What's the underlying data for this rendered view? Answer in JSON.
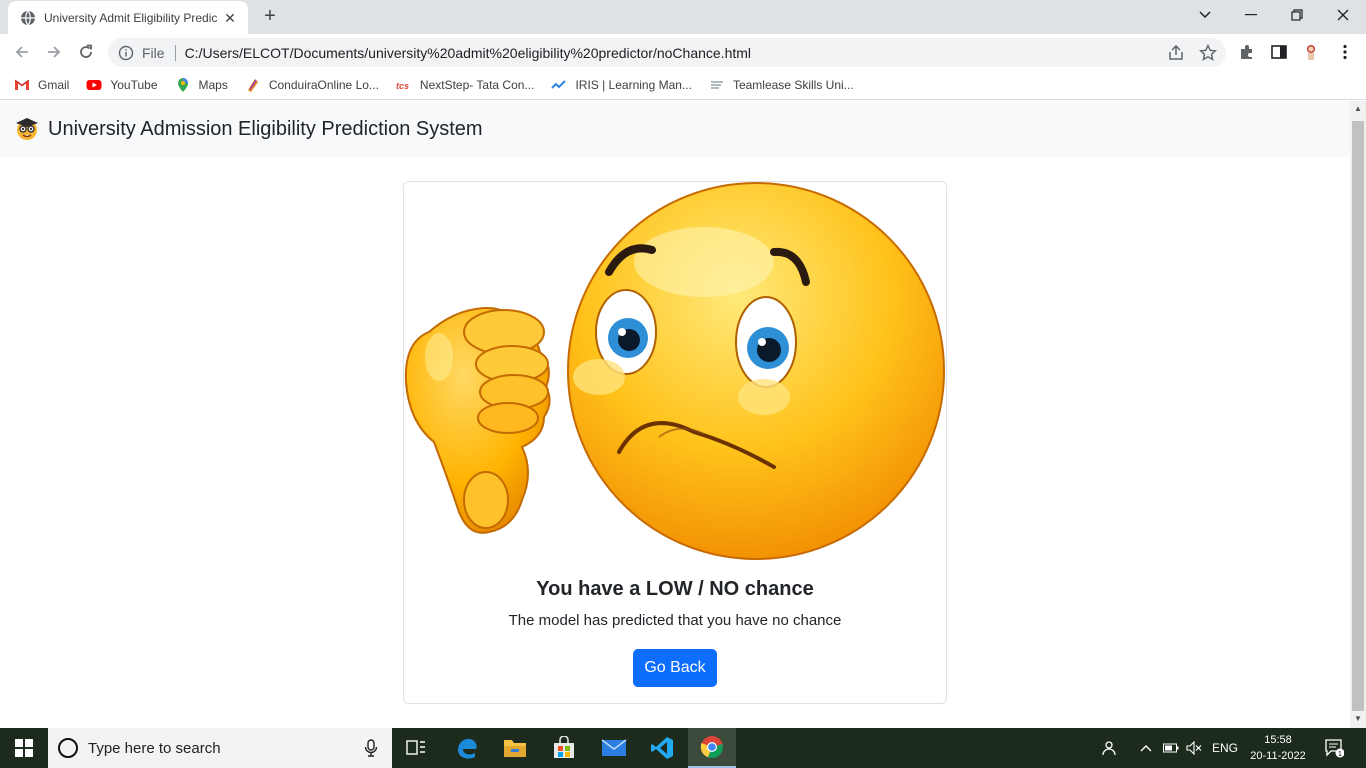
{
  "browser": {
    "tab_title": "University Admit Eligibility Predic",
    "url_scheme_label": "File",
    "url": "C:/Users/ELCOT/Documents/university%20admit%20eligibility%20predictor/noChance.html"
  },
  "bookmarks": [
    {
      "label": "Gmail",
      "icon": "gmail-icon"
    },
    {
      "label": "YouTube",
      "icon": "youtube-icon"
    },
    {
      "label": "Maps",
      "icon": "maps-icon"
    },
    {
      "label": "ConduiraOnline Lo...",
      "icon": "conduira-icon"
    },
    {
      "label": "NextStep- Tata Con...",
      "icon": "tcs-icon"
    },
    {
      "label": "IRIS | Learning Man...",
      "icon": "iris-icon"
    },
    {
      "label": "Teamlease Skills Uni...",
      "icon": "teamlease-icon"
    }
  ],
  "page": {
    "brand": "University Admission Eligibility Prediction System",
    "card": {
      "title": "You have a LOW / NO chance",
      "text": "The model has predicted that you have no chance",
      "button": "Go Back"
    }
  },
  "taskbar": {
    "search_placeholder": "Type here to search",
    "language": "ENG",
    "time": "15:58",
    "date": "20-11-2022",
    "notification_count": "1"
  },
  "colors": {
    "primary_button": "#0d6efd",
    "navbar_bg": "#f8f9fa",
    "taskbar_bg": "#1c2b1c"
  }
}
